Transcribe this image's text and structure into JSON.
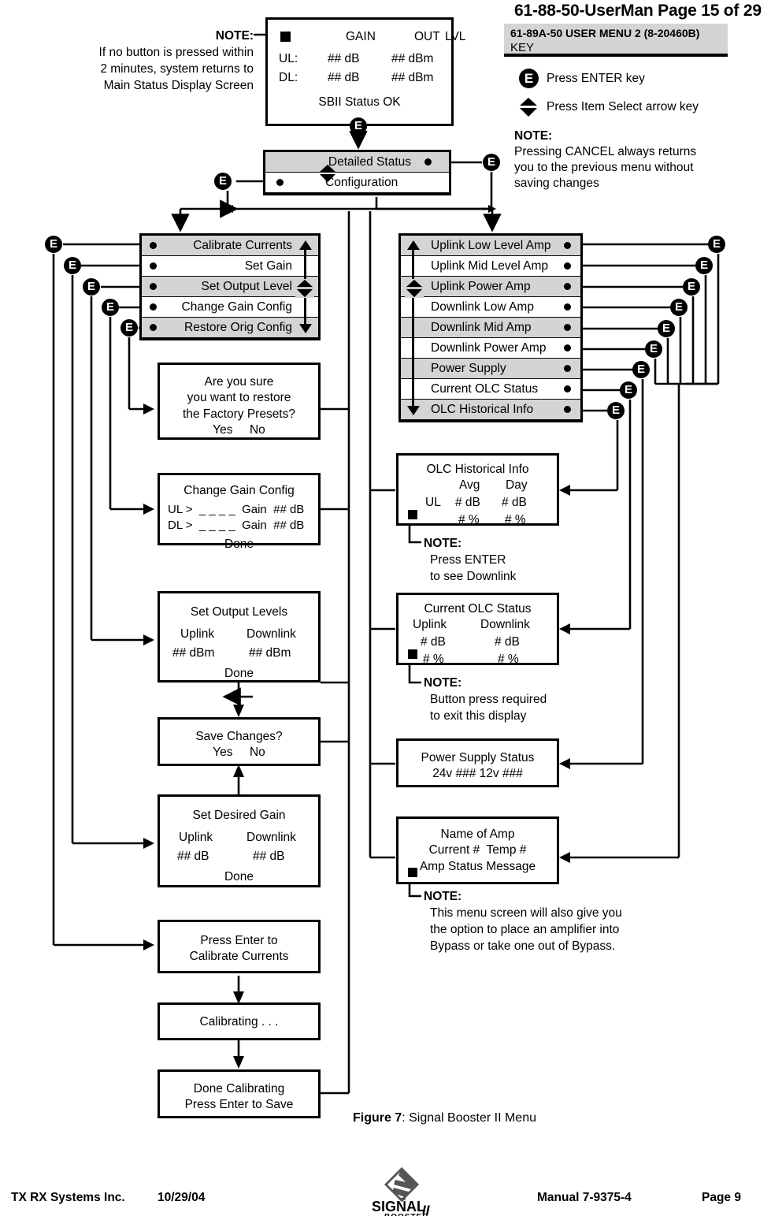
{
  "header": {
    "doc_title": "61-88-50-UserMan Page 15 of 29",
    "key_box_line1": "61-89A-50 USER MENU 2 (8-20460B)",
    "key_box_line2": "KEY",
    "legend": [
      {
        "icon": "enter-key-icon",
        "glyph": "E",
        "label": "Press ENTER key"
      },
      {
        "icon": "item-select-arrow-icon",
        "glyph": "",
        "label": "Press Item Select arrow key"
      }
    ],
    "note_label": "NOTE:",
    "note_lines": [
      "Pressing CANCEL always returns",
      "you to the previous menu without",
      "saving changes"
    ]
  },
  "timeout_note": {
    "label": "NOTE:",
    "lines": [
      "If no button is pressed within",
      "2 minutes, system returns to",
      "Main Status Display Screen"
    ]
  },
  "main_status_screen": {
    "name": "main-status-display",
    "col_gain": "GAIN",
    "col_out": "OUT",
    "col_lvl": "LVL",
    "row_ul_label": "UL:",
    "row_ul_gain": "##  dB",
    "row_ul_out": "##  dBm",
    "row_dl_label": "DL:",
    "row_dl_gain": "##  dB",
    "row_dl_out": "##  dBm",
    "status": "SBII Status OK"
  },
  "top_menu": {
    "name": "detailed-status-configuration-menu",
    "items": [
      {
        "label": "Detailed Status",
        "shaded": true
      },
      {
        "label": "Configuration",
        "shaded": false
      }
    ]
  },
  "config_menu": {
    "name": "configuration-menu",
    "items": [
      {
        "label": "Calibrate Currents",
        "shaded": true
      },
      {
        "label": "Set Gain",
        "shaded": false
      },
      {
        "label": "Set Output Level",
        "shaded": true
      },
      {
        "label": "Change Gain Config",
        "shaded": false
      },
      {
        "label": "Restore Orig Config",
        "shaded": true
      }
    ]
  },
  "status_menu": {
    "name": "detailed-status-menu",
    "items": [
      {
        "label": "Uplink Low Level Amp",
        "shaded": true
      },
      {
        "label": "Uplink Mid Level Amp",
        "shaded": false
      },
      {
        "label": "Uplink Power Amp",
        "shaded": true
      },
      {
        "label": "Downlink Low Amp",
        "shaded": false
      },
      {
        "label": "Downlink Mid Amp",
        "shaded": true
      },
      {
        "label": "Downlink Power Amp",
        "shaded": false
      },
      {
        "label": "Power Supply",
        "shaded": true
      },
      {
        "label": "Current OLC Status",
        "shaded": false
      },
      {
        "label": "OLC Historical Info",
        "shaded": true
      }
    ]
  },
  "screens": {
    "restore_confirm": {
      "name": "restore-factory-presets-confirm",
      "lines": [
        "Are you sure",
        "you want to restore",
        "the Factory Presets?",
        "Yes     No"
      ]
    },
    "change_gain_config": {
      "name": "change-gain-config-screen",
      "title": "Change Gain Config",
      "row_ul": "UL >  _ _ _ _  Gain  ## dB",
      "row_dl": "DL >  _ _ _ _  Gain  ## dB",
      "done": "Done"
    },
    "set_output_levels": {
      "name": "set-output-levels-screen",
      "title": "Set Output Levels",
      "col_uplink": "Uplink",
      "col_downlink": "Downlink",
      "val_uplink": "## dBm",
      "val_downlink": "## dBm",
      "done": "Done"
    },
    "save_changes": {
      "name": "save-changes-screen",
      "title": "Save Changes?",
      "options": "Yes     No"
    },
    "set_desired_gain": {
      "name": "set-desired-gain-screen",
      "title": "Set Desired Gain",
      "col_uplink": "Uplink",
      "col_downlink": "Downlink",
      "val_uplink": "## dB",
      "val_downlink": "## dB",
      "done": "Done"
    },
    "press_enter_calibrate": {
      "name": "press-enter-to-calibrate-screen",
      "lines": [
        "Press Enter to",
        "Calibrate Currents"
      ]
    },
    "calibrating": {
      "name": "calibrating-screen",
      "lines": [
        "Calibrating . . ."
      ]
    },
    "done_calibrating": {
      "name": "done-calibrating-screen",
      "lines": [
        "Done Calibrating",
        "Press Enter to Save"
      ]
    },
    "olc_historical": {
      "name": "olc-historical-info-screen",
      "title": "OLC Historical Info",
      "col_avg": "Avg",
      "col_day": "Day",
      "row_label": "UL",
      "db_avg": "# dB",
      "db_day": "# dB",
      "pct_avg": "# %",
      "pct_day": "# %",
      "note_label": "NOTE:",
      "note_lines": [
        "Press ENTER",
        "to see Downlink"
      ]
    },
    "current_olc": {
      "name": "current-olc-status-screen",
      "title": "Current OLC Status",
      "col_uplink": "Uplink",
      "col_downlink": "Downlink",
      "db_uplink": "# dB",
      "db_downlink": "# dB",
      "pct_uplink": "# %",
      "pct_downlink": "# %",
      "note_label": "NOTE:",
      "note_lines": [
        "Button press required",
        "to exit this display"
      ]
    },
    "power_supply": {
      "name": "power-supply-status-screen",
      "lines": [
        "Power Supply Status",
        "24v ### 12v ###"
      ]
    },
    "amp_status": {
      "name": "amp-status-screen",
      "lines": [
        "Name of Amp",
        "Current #  Temp #",
        "Amp Status Message"
      ],
      "note_label": "NOTE:",
      "note_lines": [
        "This menu screen will also give you",
        "the option to place an amplifier into",
        "Bypass or take one out of Bypass."
      ]
    }
  },
  "caption": {
    "figure": "Figure 7",
    "text": ": Signal Booster II Menu"
  },
  "footer": {
    "company": "TX RX Systems Inc.",
    "date": "10/29/04",
    "logo_main": "SIGNAL",
    "logo_sub": "BOOSTER",
    "logo_numeral": "II",
    "manual": "Manual 7-9375-4",
    "page": "Page 9"
  },
  "colors": {
    "shade": "#d4d4d4",
    "line": "#000000",
    "bg": "#ffffff"
  }
}
